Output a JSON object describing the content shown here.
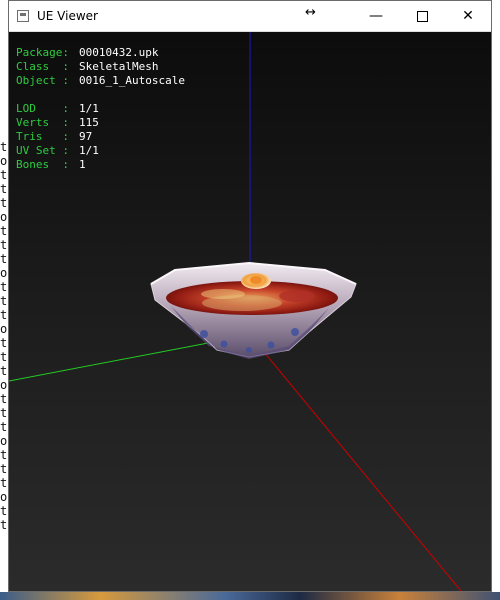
{
  "window": {
    "title": "UE Viewer",
    "icons": [
      "app-icon",
      "resize-arrows-icon",
      "minimize-icon",
      "maximize-icon",
      "close-icon"
    ]
  },
  "info": {
    "package": {
      "label": "Package:",
      "value": "00010432.upk"
    },
    "class": {
      "label": "Class  :",
      "value": "SkeletalMesh"
    },
    "object": {
      "label": "Object :",
      "value": "0016_1_Autoscale"
    },
    "lod": {
      "label": "LOD    :",
      "value": "1/1"
    },
    "verts": {
      "label": "Verts  :",
      "value": "115"
    },
    "tris": {
      "label": "Tris   :",
      "value": "97"
    },
    "uvset": {
      "label": "UV Set :",
      "value": "1/1"
    },
    "bones": {
      "label": "Bones  :",
      "value": "1"
    }
  },
  "background_console": {
    "left_column_chars": [
      "t",
      "o",
      "t",
      "t",
      "t",
      "o",
      "t",
      "t",
      "t",
      "o",
      "t",
      "t",
      "t",
      "o",
      "t",
      "t",
      "t",
      "o",
      "t",
      "t",
      "t",
      "o",
      "t",
      "t",
      "t",
      "o",
      "t",
      "t"
    ]
  },
  "colors": {
    "label_green": "#2ecc40",
    "axis_x": "#cc0000",
    "axis_y": "#22cc22",
    "axis_z": "#1a1acc"
  }
}
